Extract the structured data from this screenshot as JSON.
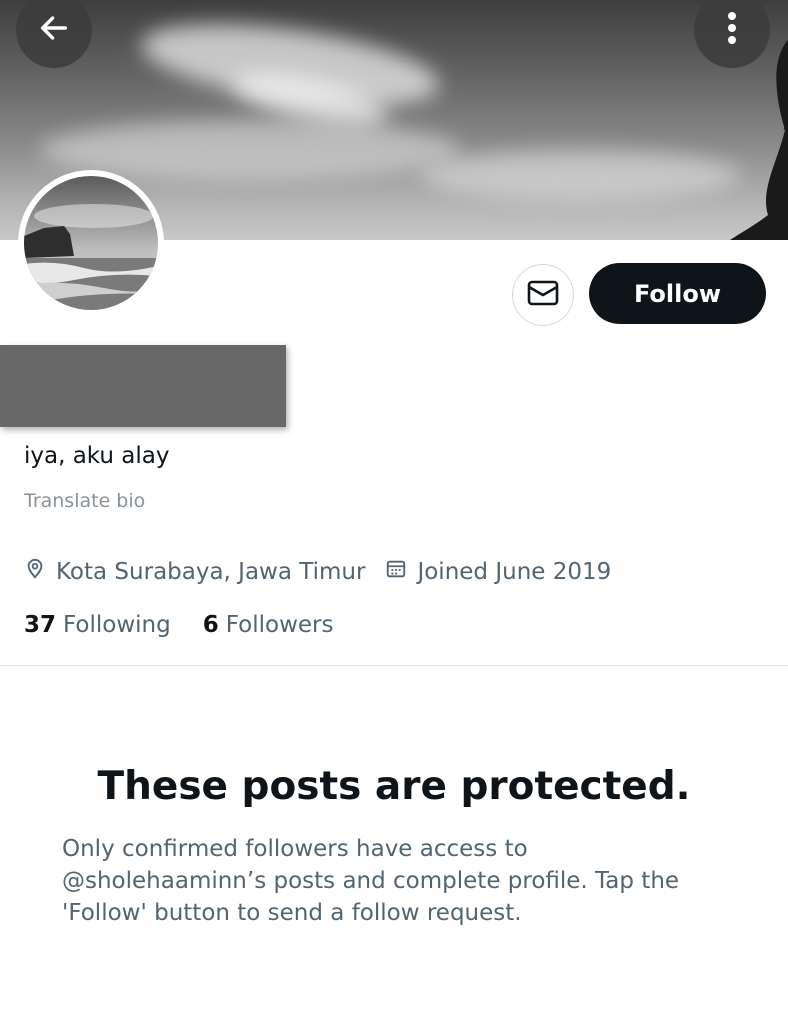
{
  "profile": {
    "bio": "iya, aku alay",
    "translate_label": "Translate bio",
    "location": "Kota Surabaya, Jawa Timur",
    "joined": "Joined June 2019",
    "following_count": "37",
    "following_label": "Following",
    "followers_count": "6",
    "followers_label": "Followers"
  },
  "actions": {
    "follow_label": "Follow"
  },
  "protected": {
    "title": "These posts are protected.",
    "description": "Only confirmed followers have access to @sholehaaminn’s posts and complete profile. Tap the 'Follow' button to send a follow request."
  },
  "icons": {
    "back": "arrow-left-icon",
    "more": "vertical-dots-icon",
    "message": "envelope-icon",
    "location": "map-pin-icon",
    "calendar": "calendar-icon"
  }
}
